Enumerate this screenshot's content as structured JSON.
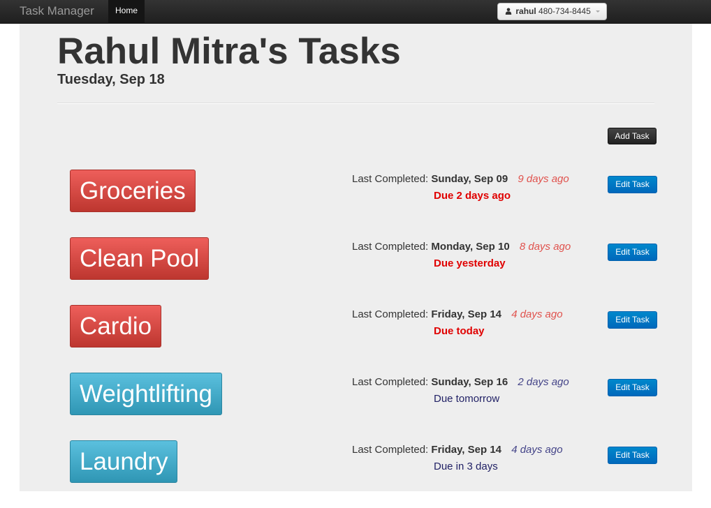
{
  "navbar": {
    "brand": "Task Manager",
    "home_label": "Home",
    "user_name": "rahul",
    "user_phone": "480-734-8445"
  },
  "header": {
    "title": "Rahul Mitra's Tasks",
    "date": "Tuesday, Sep 18"
  },
  "actions": {
    "add_task_label": "Add Task"
  },
  "tasks": [
    {
      "name": "Groceries",
      "status": "danger",
      "last_completed_label": "Last Completed:",
      "last_completed_date": "Sunday, Sep 09",
      "ago": "9 days ago",
      "due": "Due 2 days ago",
      "edit_label": "Edit Task"
    },
    {
      "name": "Clean Pool",
      "status": "danger",
      "last_completed_label": "Last Completed:",
      "last_completed_date": "Monday, Sep 10",
      "ago": "8 days ago",
      "due": "Due yesterday",
      "edit_label": "Edit Task"
    },
    {
      "name": "Cardio",
      "status": "danger",
      "last_completed_label": "Last Completed:",
      "last_completed_date": "Friday, Sep 14",
      "ago": "4 days ago",
      "due": "Due today",
      "edit_label": "Edit Task"
    },
    {
      "name": "Weightlifting",
      "status": "info",
      "last_completed_label": "Last Completed:",
      "last_completed_date": "Sunday, Sep 16",
      "ago": "2 days ago",
      "due": "Due tomorrow",
      "edit_label": "Edit Task"
    },
    {
      "name": "Laundry",
      "status": "info",
      "last_completed_label": "Last Completed:",
      "last_completed_date": "Friday, Sep 14",
      "ago": "4 days ago",
      "due": "Due in 3 days",
      "edit_label": "Edit Task"
    }
  ],
  "colors": {
    "overdue_button": "#da4f49",
    "upcoming_button": "#49afcd",
    "overdue_text": "#e00000",
    "upcoming_text": "#222266",
    "edit_button": "#0074cc"
  }
}
